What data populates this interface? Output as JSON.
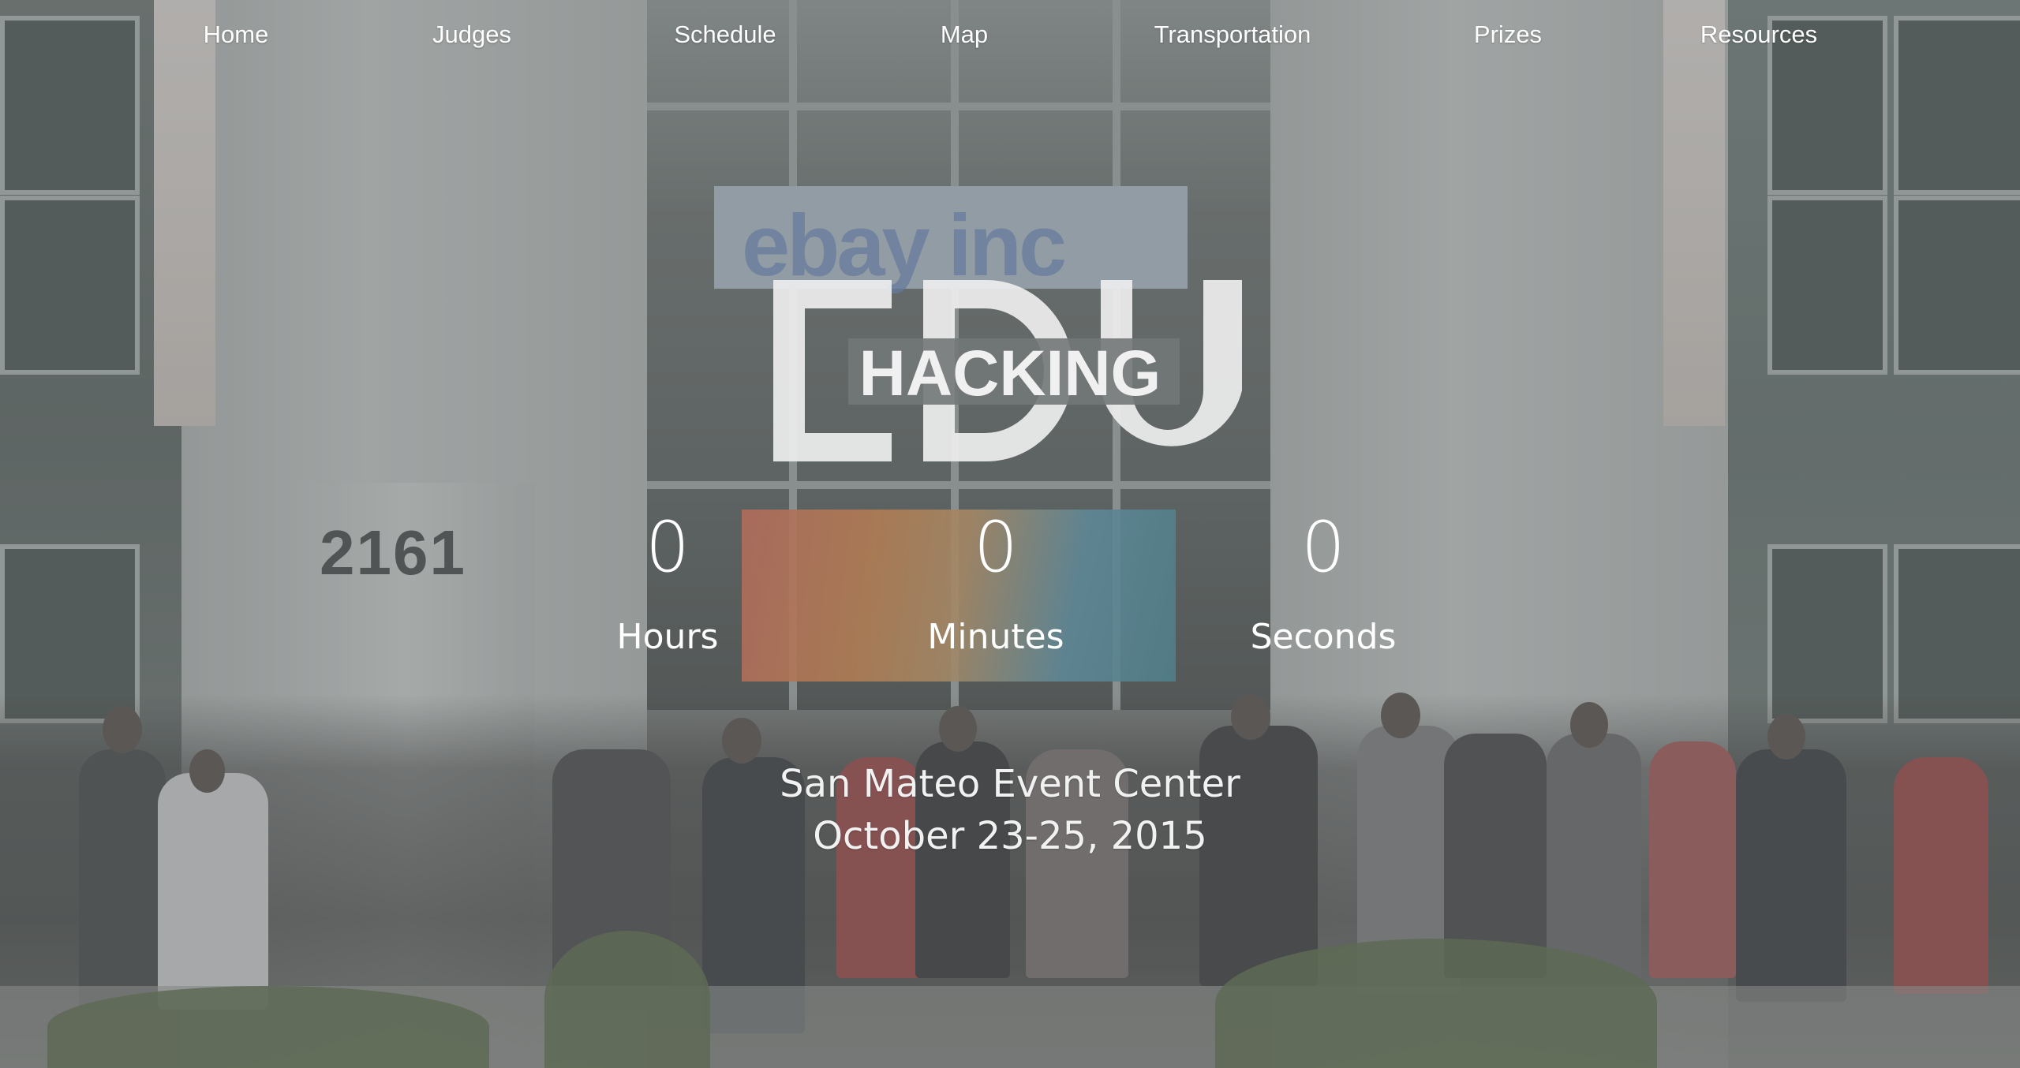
{
  "nav": {
    "items": [
      {
        "label": "Home"
      },
      {
        "label": "Judges"
      },
      {
        "label": "Schedule"
      },
      {
        "label": "Map"
      },
      {
        "label": "Transportation"
      },
      {
        "label": "Prizes"
      },
      {
        "label": "Resources"
      }
    ]
  },
  "logo": {
    "big": "EDU",
    "overlay": "HACKING"
  },
  "countdown": {
    "hours_value": "0",
    "hours_label": "Hours",
    "minutes_value": "0",
    "minutes_label": "Minutes",
    "seconds_value": "0",
    "seconds_label": "Seconds"
  },
  "event": {
    "venue": "San Mateo Event Center",
    "dates": "October 23-25, 2015"
  },
  "background": {
    "pillar_number": "2161",
    "sign_text": "ebay inc"
  },
  "colors": {
    "text": "#ffffff",
    "logo": "#efefef"
  }
}
